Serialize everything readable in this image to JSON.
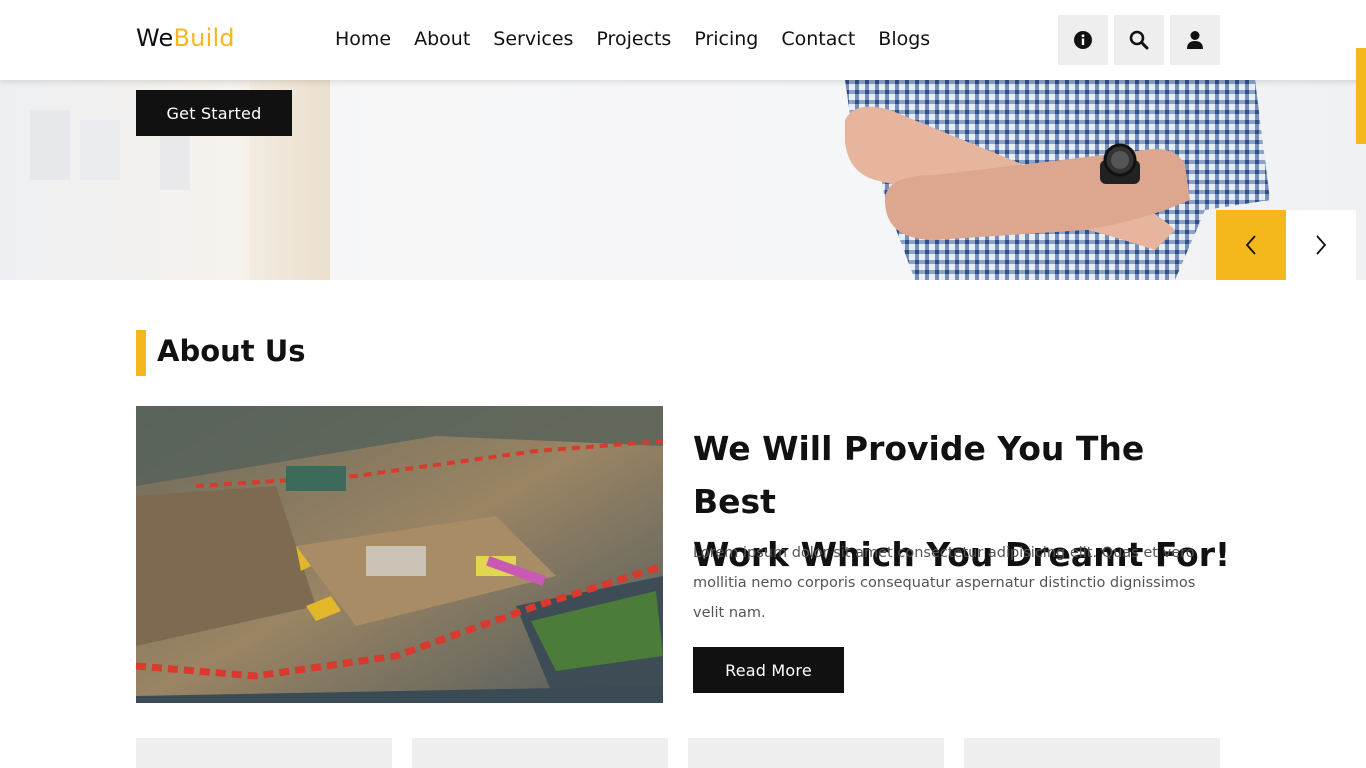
{
  "header": {
    "logo_we": "We",
    "logo_build": "Build",
    "nav": [
      "Home",
      "About",
      "Services",
      "Projects",
      "Pricing",
      "Contact",
      "Blogs"
    ],
    "icons": [
      "info-icon",
      "search-icon",
      "user-icon"
    ]
  },
  "hero": {
    "cta_label": "Get Started",
    "prev_icon": "chevron-left-icon",
    "next_icon": "chevron-right-icon"
  },
  "about": {
    "section_title": "About Us",
    "heading_line1": "We Will Provide You The Best",
    "heading_line2": "Work Which You Dreamt For!",
    "body": "Lorem ipsum dolor sit amet consectetur adipisicing elit. Quas et vero mollitia nemo corporis consequatur aspernatur distinctio dignissimos velit nam.",
    "button_label": "Read More"
  },
  "colors": {
    "accent": "#f5b81c",
    "dark": "#111111",
    "light_gray": "#eeeeee"
  }
}
